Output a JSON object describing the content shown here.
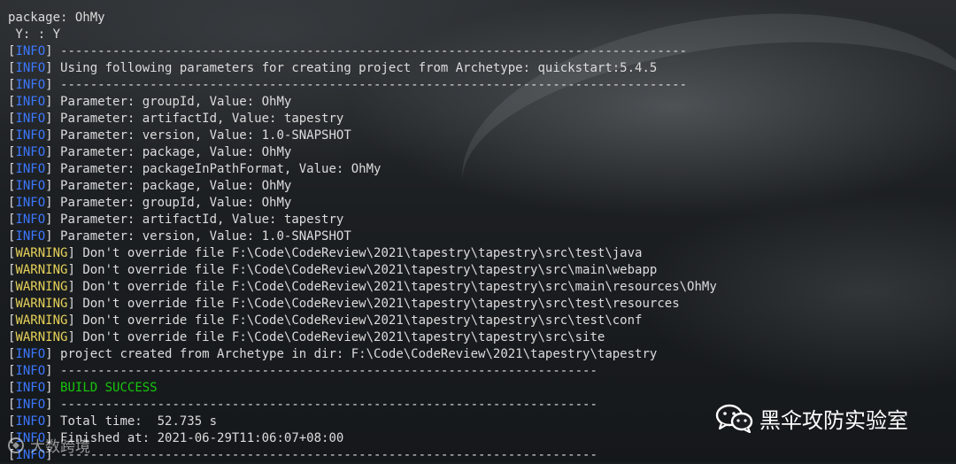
{
  "console": {
    "lines": [
      {
        "tag": "",
        "tag_type": "",
        "text": "package: OhMy"
      },
      {
        "tag": "",
        "tag_type": "",
        "text": " Y: : Y"
      },
      {
        "tag": "INFO",
        "tag_type": "info",
        "text": " ------------------------------------------------------------------------------------"
      },
      {
        "tag": "INFO",
        "tag_type": "info",
        "text": " Using following parameters for creating project from Archetype: quickstart:5.4.5"
      },
      {
        "tag": "INFO",
        "tag_type": "info",
        "text": " ------------------------------------------------------------------------------------"
      },
      {
        "tag": "INFO",
        "tag_type": "info",
        "text": " Parameter: groupId, Value: OhMy"
      },
      {
        "tag": "INFO",
        "tag_type": "info",
        "text": " Parameter: artifactId, Value: tapestry"
      },
      {
        "tag": "INFO",
        "tag_type": "info",
        "text": " Parameter: version, Value: 1.0-SNAPSHOT"
      },
      {
        "tag": "INFO",
        "tag_type": "info",
        "text": " Parameter: package, Value: OhMy"
      },
      {
        "tag": "INFO",
        "tag_type": "info",
        "text": " Parameter: packageInPathFormat, Value: OhMy"
      },
      {
        "tag": "INFO",
        "tag_type": "info",
        "text": " Parameter: package, Value: OhMy"
      },
      {
        "tag": "INFO",
        "tag_type": "info",
        "text": " Parameter: groupId, Value: OhMy"
      },
      {
        "tag": "INFO",
        "tag_type": "info",
        "text": " Parameter: artifactId, Value: tapestry"
      },
      {
        "tag": "INFO",
        "tag_type": "info",
        "text": " Parameter: version, Value: 1.0-SNAPSHOT"
      },
      {
        "tag": "WARNING",
        "tag_type": "warn",
        "text": " Don't override file F:\\Code\\CodeReview\\2021\\tapestry\\tapestry\\src\\test\\java"
      },
      {
        "tag": "WARNING",
        "tag_type": "warn",
        "text": " Don't override file F:\\Code\\CodeReview\\2021\\tapestry\\tapestry\\src\\main\\webapp"
      },
      {
        "tag": "WARNING",
        "tag_type": "warn",
        "text": " Don't override file F:\\Code\\CodeReview\\2021\\tapestry\\tapestry\\src\\main\\resources\\OhMy"
      },
      {
        "tag": "WARNING",
        "tag_type": "warn",
        "text": " Don't override file F:\\Code\\CodeReview\\2021\\tapestry\\tapestry\\src\\test\\resources"
      },
      {
        "tag": "WARNING",
        "tag_type": "warn",
        "text": " Don't override file F:\\Code\\CodeReview\\2021\\tapestry\\tapestry\\src\\test\\conf"
      },
      {
        "tag": "WARNING",
        "tag_type": "warn",
        "text": " Don't override file F:\\Code\\CodeReview\\2021\\tapestry\\tapestry\\src\\site"
      },
      {
        "tag": "INFO",
        "tag_type": "info",
        "text": " project created from Archetype in dir: F:\\Code\\CodeReview\\2021\\tapestry\\tapestry"
      },
      {
        "tag": "INFO",
        "tag_type": "info",
        "text": " ------------------------------------------------------------------------"
      },
      {
        "tag": "INFO",
        "tag_type": "info",
        "text": " ",
        "success": "BUILD SUCCESS"
      },
      {
        "tag": "INFO",
        "tag_type": "info",
        "text": " ------------------------------------------------------------------------"
      },
      {
        "tag": "INFO",
        "tag_type": "info",
        "text": " Total time:  52.735 s"
      },
      {
        "tag": "INFO",
        "tag_type": "info",
        "text": " Finished at: 2021-06-29T11:06:07+08:00"
      },
      {
        "tag": "INFO",
        "tag_type": "info",
        "text": " ------------------------------------------------------------------------"
      }
    ]
  },
  "watermark": {
    "text": "黑伞攻防实验室",
    "icon": "wechat-icon"
  },
  "corner_mark": {
    "text": "大数跨境",
    "icon": "logo-icon"
  },
  "colors": {
    "info_tag": "#3b78ff",
    "warning_tag": "#e5d15a",
    "success": "#16c60c",
    "text": "#dcdcdc"
  }
}
